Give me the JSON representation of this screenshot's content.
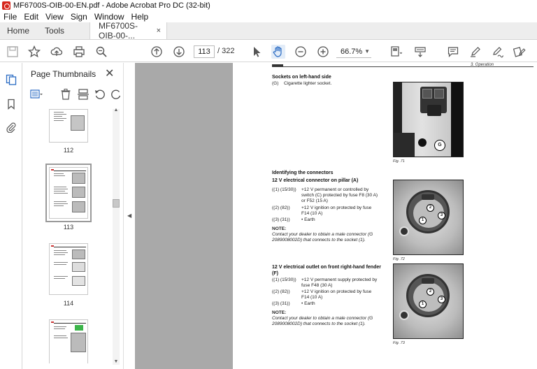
{
  "window": {
    "title": "MF6700S-OIB-00-EN.pdf - Adobe Acrobat Pro DC (32-bit)"
  },
  "menu": [
    "File",
    "Edit",
    "View",
    "Sign",
    "Window",
    "Help"
  ],
  "tabs": {
    "home": "Home",
    "tools": "Tools",
    "document": "MF6700S-OIB-00-...",
    "close": "×"
  },
  "toolbar": {
    "current_page": "113",
    "total_pages": "/ 322",
    "zoom": "66.7%"
  },
  "thumbnails": {
    "title": "Page Thumbnails",
    "close": "✕",
    "pages": [
      {
        "label": "112"
      },
      {
        "label": "113"
      },
      {
        "label": "114"
      }
    ]
  },
  "page": {
    "header": "3. Operation",
    "sections": {
      "sockets_title": "Sockets on left-hand side",
      "sockets_g_key": "(G)",
      "sockets_g_text": "Cigarette lighter socket.",
      "fig71": "Fig. 71",
      "fig71_label": "G",
      "ident_title": "Identifying the connectors",
      "pillar_title": "12 V electrical connector on pillar (A)",
      "pillar_rows": [
        {
          "key": "((1) (15/30))",
          "text": "+12 V permanent or controlled by switch (C) protected by fuse F8 (30 A) or F52 (15 A)"
        },
        {
          "key": "((2) (82))",
          "text": "+12 V ignition on protected by fuse F14 (10 A)"
        },
        {
          "key": "((3) (31))",
          "text": "• Earth"
        }
      ],
      "note1_title": "NOTE:",
      "note1_text": "Contact your dealer to obtain a male connector (G 2089008002D) that connects to the socket (1).",
      "fig72": "Fig. 72",
      "fender_title": "12 V electrical outlet on front right-hand fender (F)",
      "fender_rows": [
        {
          "key": "((1) (15/30))",
          "text": "+12 V permanent supply protected by fuse F48 (30 A)"
        },
        {
          "key": "((2) (82))",
          "text": "+12 V ignition on protected by fuse F14 (10 A)"
        },
        {
          "key": "((3) (31))",
          "text": "• Earth"
        }
      ],
      "note2_title": "NOTE:",
      "note2_text": "Contact your dealer to obtain a male connector (G 2089008002D) that connects to the socket (1).",
      "fig73": "Fig. 73"
    }
  }
}
